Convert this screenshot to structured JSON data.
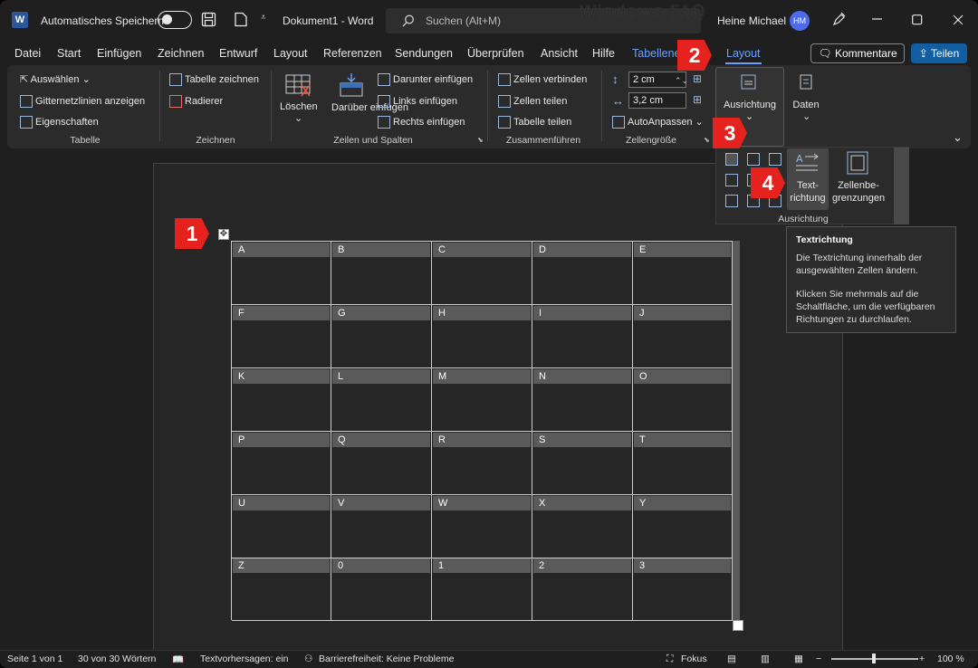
{
  "titlebar": {
    "autosave_label": "Automatisches Speichern",
    "doc_title": "Dokument1  -  Word",
    "search_placeholder": "Suchen (Alt+M)",
    "user_name": "Heine Michael",
    "user_initials": "HM",
    "watermark": "Windows-FAQ"
  },
  "menu": {
    "items": [
      "Datei",
      "Start",
      "Einfügen",
      "Zeichnen",
      "Entwurf",
      "Layout",
      "Referenzen",
      "Sendungen",
      "Überprüfen",
      "Ansicht",
      "Hilfe",
      "Tabellene",
      "Layout"
    ],
    "comment_button": "Kommentare",
    "share_button": "Teilen"
  },
  "ribbon": {
    "tabelle": {
      "select": "Auswählen",
      "gridlines": "Gitternetzlinien anzeigen",
      "properties": "Eigenschaften",
      "group": "Tabelle"
    },
    "zeichnen": {
      "draw": "Tabelle zeichnen",
      "eraser": "Radierer",
      "group": "Zeichnen"
    },
    "zeilen": {
      "delete": "Löschen",
      "above": "Darüber einfügen",
      "below": "Darunter einfügen",
      "left": "Links einfügen",
      "right": "Rechts einfügen",
      "group": "Zeilen und Spalten"
    },
    "zusammen": {
      "merge": "Zellen verbinden",
      "split_cells": "Zellen teilen",
      "split_table": "Tabelle teilen",
      "group": "Zusammenführen"
    },
    "groesse": {
      "height": "2 cm",
      "width": "3,2 cm",
      "autofit": "AutoAnpassen",
      "group": "Zellengröße"
    },
    "ausrichtung": {
      "label": "Ausrichtung"
    },
    "daten": {
      "label": "Daten"
    }
  },
  "align_panel": {
    "text_direction_line1": "Text-",
    "text_direction_line2": "richtung",
    "cell_margins_line1": "Zellenbe-",
    "cell_margins_line2": "grenzungen",
    "group": "Ausrichtung"
  },
  "tooltip": {
    "title": "Textrichtung",
    "line1": "Die Textrichtung innerhalb der ausgewählten Zellen ändern.",
    "line2": "Klicken Sie mehrmals auf die Schaltfläche, um die verfügbaren Richtungen zu durchlaufen."
  },
  "callouts": [
    "1",
    "2",
    "3",
    "4"
  ],
  "table": {
    "rows": [
      [
        "A",
        "B",
        "C",
        "D",
        "E"
      ],
      [
        "F",
        "G",
        "H",
        "I",
        "J"
      ],
      [
        "K",
        "L",
        "M",
        "N",
        "O"
      ],
      [
        "P",
        "Q",
        "R",
        "S",
        "T"
      ],
      [
        "U",
        "V",
        "W",
        "X",
        "Y"
      ],
      [
        "Z",
        "0",
        "1",
        "2",
        "3"
      ]
    ]
  },
  "status": {
    "page": "Seite 1 von 1",
    "words": "30 von 30 Wörtern",
    "predictions": "Textvorhersagen: ein",
    "accessibility": "Barrierefreiheit: Keine Probleme",
    "focus": "Fokus",
    "zoom": "100 %"
  },
  "colors": {
    "accent": "#6ca0ff",
    "share": "#115ea3",
    "callout": "#e6221e",
    "avatar": "#4f6bed"
  }
}
